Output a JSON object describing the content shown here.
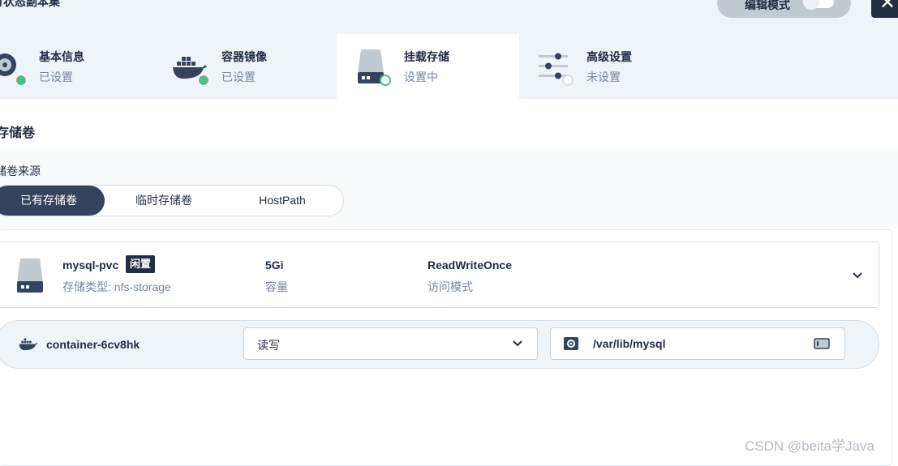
{
  "header": {
    "title": "有状态副本集",
    "edit_mode_label": "编辑模式",
    "close_label": "✕"
  },
  "steps": [
    {
      "name": "基本信息",
      "status": "已设置",
      "icon": "info-disc-icon"
    },
    {
      "name": "容器镜像",
      "status": "已设置",
      "icon": "docker-icon"
    },
    {
      "name": "挂载存储",
      "status": "设置中",
      "icon": "storage-icon"
    },
    {
      "name": "高级设置",
      "status": "未设置",
      "icon": "sliders-icon"
    }
  ],
  "section": {
    "title": "存储卷",
    "source_label": "储卷来源",
    "source_tabs": [
      "已有存储卷",
      "临时存储卷",
      "HostPath"
    ],
    "selected_tab": "已有存储卷"
  },
  "pvc": {
    "name": "mysql-pvc",
    "badge": "闲置",
    "storage_type": "存储类型: nfs-storage",
    "capacity": "5Gi",
    "capacity_label": "容量",
    "access_mode": "ReadWriteOnce",
    "access_mode_label": "访问模式"
  },
  "mount": {
    "container": "container-6cv8hk",
    "mode": "读写",
    "path": "/var/lib/mysql"
  },
  "watermark": "CSDN @beita学Java",
  "colors": {
    "dark": "#242e42",
    "success": "#55bc8a",
    "muted": "#79879c",
    "panel": "#eff4f9"
  }
}
